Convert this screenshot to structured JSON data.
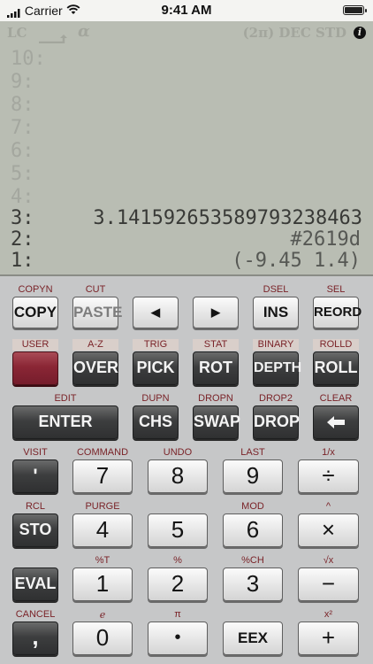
{
  "status": {
    "carrier": "Carrier",
    "time": "9:41 AM",
    "battery_level": 1.0
  },
  "annunciators": {
    "lc": "LC",
    "alpha": "α",
    "right": "(2π) DEC STD",
    "info": "i"
  },
  "stack": [
    {
      "level": "10:",
      "value": ""
    },
    {
      "level": "9:",
      "value": ""
    },
    {
      "level": "8:",
      "value": ""
    },
    {
      "level": "7:",
      "value": ""
    },
    {
      "level": "6:",
      "value": ""
    },
    {
      "level": "5:",
      "value": ""
    },
    {
      "level": "4:",
      "value": ""
    },
    {
      "level": "3:",
      "value": "3.1415926535897932384​63"
    },
    {
      "level": "2:",
      "value": "#2619d"
    },
    {
      "level": "1:",
      "value": "(-9.45 1.4)"
    }
  ],
  "keys": {
    "r1": {
      "copy": {
        "shift": "COPYN",
        "label": "COPY"
      },
      "paste": {
        "shift": "CUT",
        "label": "PASTE"
      },
      "left": {
        "label": "◀"
      },
      "right": {
        "label": "▶"
      },
      "ins": {
        "shift": "DSEL",
        "label": "INS"
      },
      "reord": {
        "shift": "SEL",
        "label": "REORD"
      }
    },
    "r2": {
      "user": {
        "shift": "USER",
        "label": ""
      },
      "over": {
        "shift": "A-Z",
        "label": "OVER"
      },
      "pick": {
        "shift": "TRIG",
        "label": "PICK"
      },
      "rot": {
        "shift": "STAT",
        "label": "ROT"
      },
      "depth": {
        "shift": "BINARY",
        "label": "DEPTH"
      },
      "roll": {
        "shift": "ROLLD",
        "label": "ROLL"
      }
    },
    "r3": {
      "enter": {
        "shift": "EDIT",
        "label": "ENTER"
      },
      "chs": {
        "shift": "DUPN",
        "label": "CHS"
      },
      "swap": {
        "shift": "DROPN",
        "label": "SWAP"
      },
      "drop": {
        "shift": "DROP2",
        "label": "DROP"
      },
      "back": {
        "shift": "CLEAR",
        "label": "🡐"
      }
    },
    "r4": {
      "quote": {
        "shift": "VISIT",
        "label": "'"
      },
      "seven": {
        "shift": "COMMAND",
        "label": "7"
      },
      "eight": {
        "shift": "UNDO",
        "label": "8"
      },
      "nine": {
        "shift": "LAST",
        "label": "9"
      },
      "div": {
        "shift": "1/x",
        "label": "÷"
      }
    },
    "r5": {
      "sto": {
        "shift": "RCL",
        "label": "STO"
      },
      "four": {
        "shift": "PURGE",
        "label": "4"
      },
      "five": {
        "shift": "",
        "label": "5"
      },
      "six": {
        "shift": "MOD",
        "label": "6"
      },
      "mul": {
        "shift": "^",
        "label": "×"
      }
    },
    "r6": {
      "eval": {
        "shift": "",
        "label": "EVAL"
      },
      "one": {
        "shift": "%T",
        "label": "1"
      },
      "two": {
        "shift": "%",
        "label": "2"
      },
      "three": {
        "shift": "%CH",
        "label": "3"
      },
      "sub": {
        "shift": "√x",
        "label": "−"
      }
    },
    "r7": {
      "comma": {
        "shift": "CANCEL",
        "label": ","
      },
      "zero": {
        "shift": "e",
        "label": "0"
      },
      "dot": {
        "shift": "π",
        "label": "•"
      },
      "eex": {
        "shift": "",
        "label": "EEX"
      },
      "add": {
        "shift": "x²",
        "label": "+"
      }
    }
  }
}
